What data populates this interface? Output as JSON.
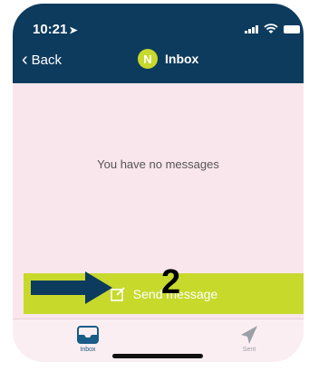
{
  "status_bar": {
    "time": "10:21"
  },
  "nav": {
    "back_label": "Back",
    "avatar_letter": "N",
    "title": "Inbox"
  },
  "main": {
    "empty_message": "You have no messages"
  },
  "send_button": {
    "label": "Send message"
  },
  "tabs": [
    {
      "label": "Inbox",
      "active": true
    },
    {
      "label": "Sent",
      "active": false
    }
  ],
  "annotation": {
    "step_number": "2"
  },
  "colors": {
    "header": "#0d3b5e",
    "accent": "#c7d92b",
    "background": "#f9e6ec"
  }
}
